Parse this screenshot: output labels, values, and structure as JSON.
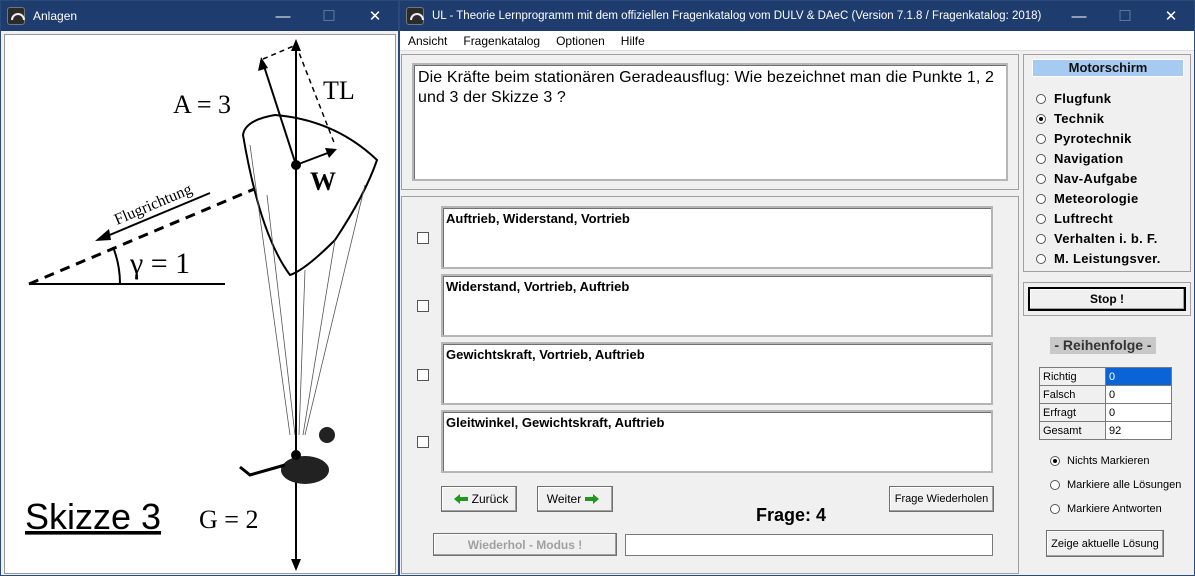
{
  "left_window": {
    "title": "Anlagen",
    "controls": {
      "minimize": "—",
      "maximize": "☐",
      "close": "✕"
    },
    "sketch": {
      "caption": "Skizze 3",
      "labels": {
        "a": "A = 3",
        "tl": "TL",
        "w": "W",
        "flight": "Flugrichtung",
        "gamma": "γ = 1",
        "g": "G = 2"
      }
    }
  },
  "right_window": {
    "title": "UL - Theorie Lernprogramm mit dem offiziellen Fragenkatalog vom DULV & DAeC (Version 7.1.8 / Fragenkatalog: 2018)",
    "controls": {
      "minimize": "—",
      "maximize": "☐",
      "close": "✕"
    },
    "menu": [
      "Ansicht",
      "Fragenkatalog",
      "Optionen",
      "Hilfe"
    ],
    "question": "Die Kräfte beim stationären Geradeausflug: Wie bezeichnet man die Punkte 1, 2 und 3 der Skizze 3 ?",
    "answers": [
      {
        "text": "Auftrieb, Widerstand, Vortrieb",
        "checked": false
      },
      {
        "text": "Widerstand, Vortrieb, Auftrieb",
        "checked": false
      },
      {
        "text": "Gewichtskraft, Vortrieb, Auftrieb",
        "checked": false
      },
      {
        "text": "Gleitwinkel, Gewichtskraft, Auftrieb",
        "checked": false
      }
    ],
    "buttons": {
      "back": "Zurück",
      "next": "Weiter",
      "repeat_question": "Frage Wiederholen",
      "repeat_mode": "Wiederhol - Modus !",
      "stop": "Stop !",
      "show_solution": "Zeige aktuelle Lösung"
    },
    "question_number_label": "Frage:",
    "question_number": "4",
    "status_field": "",
    "category_header": "Motorschirm",
    "categories": [
      {
        "label": "Flugfunk",
        "selected": false
      },
      {
        "label": "Technik",
        "selected": true
      },
      {
        "label": "Pyrotechnik",
        "selected": false
      },
      {
        "label": "Navigation",
        "selected": false
      },
      {
        "label": "Nav-Aufgabe",
        "selected": false
      },
      {
        "label": "Meteorologie",
        "selected": false
      },
      {
        "label": "Luftrecht",
        "selected": false
      },
      {
        "label": "Verhalten i. b. F.",
        "selected": false
      },
      {
        "label": "M. Leistungsver.",
        "selected": false
      }
    ],
    "order_label": "- Reihenfolge -",
    "stats": [
      {
        "label": "Richtig",
        "value": "0"
      },
      {
        "label": "Falsch",
        "value": "0"
      },
      {
        "label": "Erfragt",
        "value": "0"
      },
      {
        "label": "Gesamt",
        "value": "92"
      }
    ],
    "mark_options": [
      {
        "label": "Nichts Markieren",
        "selected": true
      },
      {
        "label": "Markiere alle Lösungen",
        "selected": false
      },
      {
        "label": "Markiere Antworten",
        "selected": false
      }
    ],
    "colors": {
      "title_bar": "#1e3c6e",
      "category_header_bg": "#a6caf0",
      "selected_cell": "#0a64d8"
    }
  }
}
